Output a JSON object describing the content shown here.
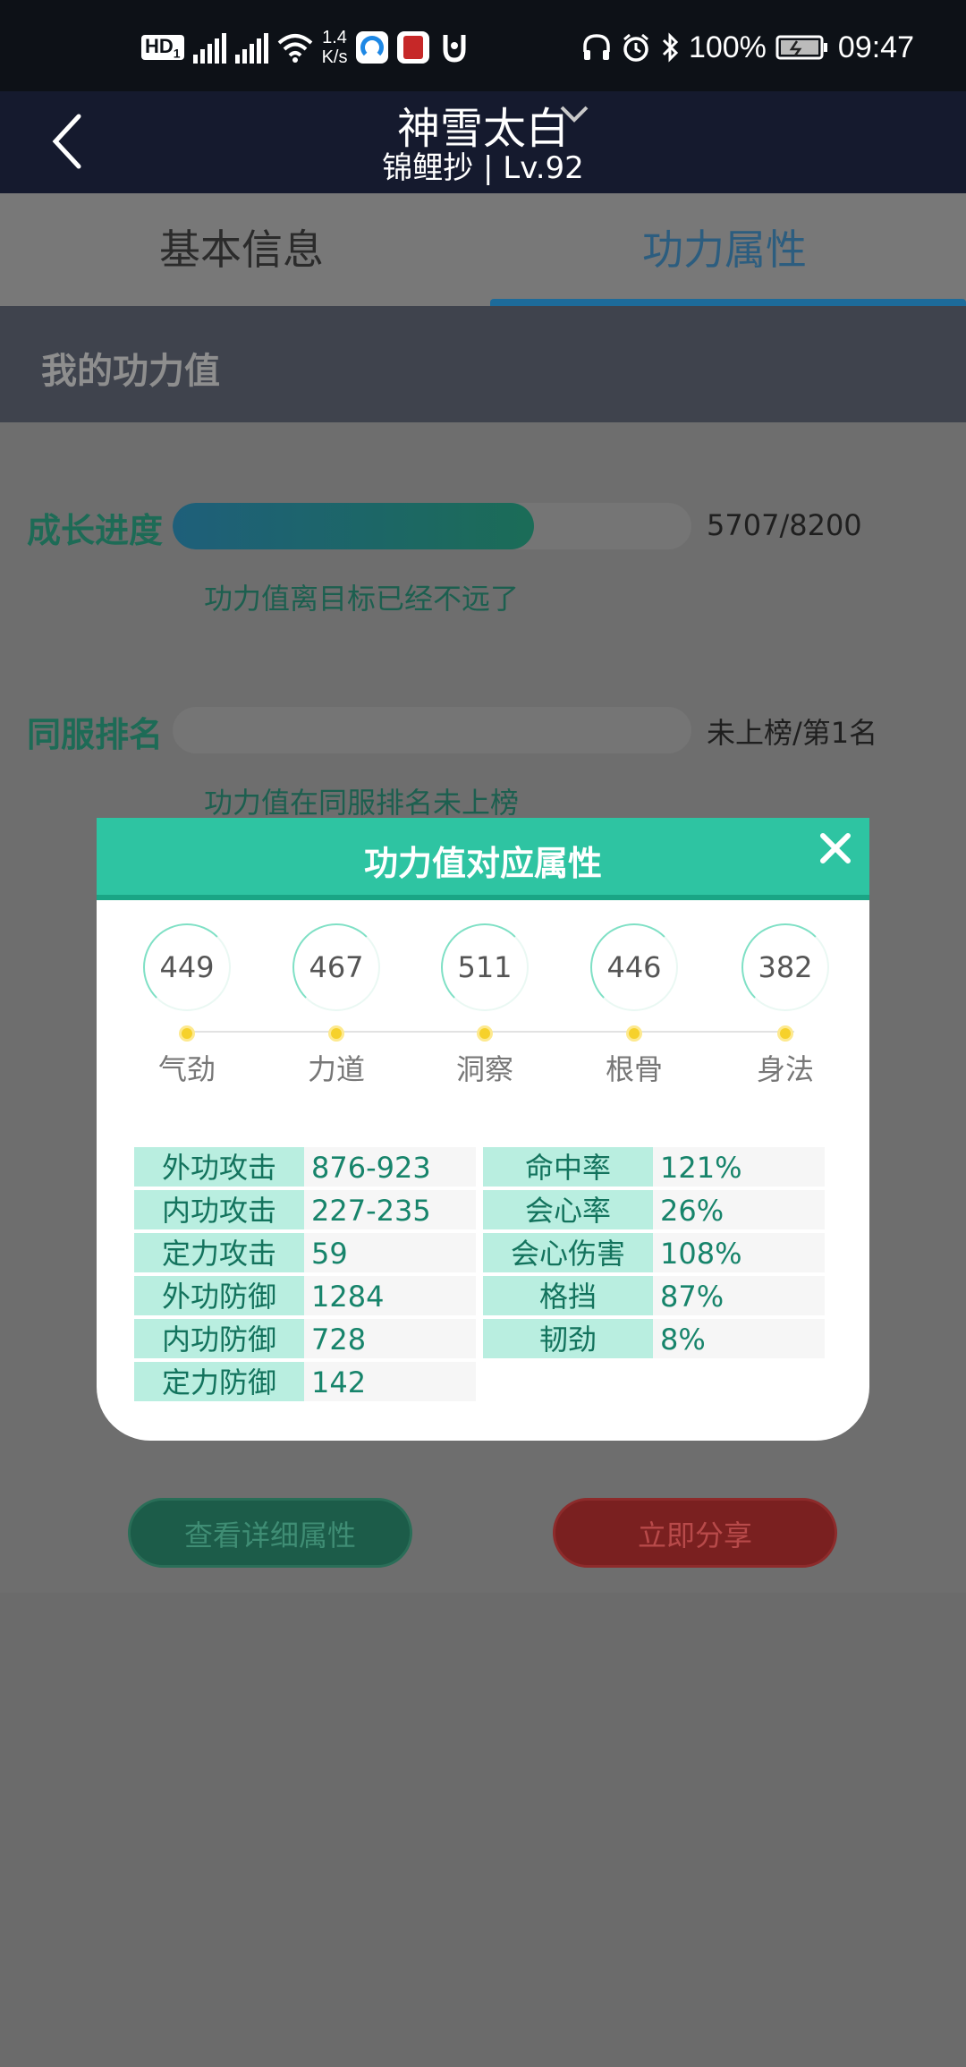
{
  "status_bar": {
    "hd_label": "HD",
    "hd_sub": "1",
    "net_speed_value": "1.4",
    "net_speed_unit": "K/s",
    "battery": "100%",
    "time": "09:47"
  },
  "header": {
    "title": "神雪太白",
    "subtitle": "锦鲤抄 | Lv.92"
  },
  "tabs": [
    {
      "label": "基本信息",
      "active": false
    },
    {
      "label": "功力属性",
      "active": true
    }
  ],
  "section": {
    "title": "我的功力值"
  },
  "growth": {
    "label": "成长进度",
    "current": 5707,
    "target": 8200,
    "value_text": "5707/8200",
    "hint": "功力值离目标已经不远了"
  },
  "ranking": {
    "label": "同服排名",
    "progress": 0,
    "value_text": "未上榜/第1名",
    "hint": "功力值在同服排名未上榜"
  },
  "buttons": {
    "detail": "查看详细属性",
    "share": "立即分享"
  },
  "modal": {
    "title": "功力值对应属性",
    "stats": [
      {
        "value": "449",
        "label": "气劲"
      },
      {
        "value": "467",
        "label": "力道"
      },
      {
        "value": "511",
        "label": "洞察"
      },
      {
        "value": "446",
        "label": "根骨"
      },
      {
        "value": "382",
        "label": "身法"
      }
    ],
    "attributes_left": [
      {
        "name": "外功攻击",
        "value": "876-923"
      },
      {
        "name": "内功攻击",
        "value": "227-235"
      },
      {
        "name": "定力攻击",
        "value": "59"
      },
      {
        "name": "外功防御",
        "value": "1284"
      },
      {
        "name": "内功防御",
        "value": "728"
      },
      {
        "name": "定力防御",
        "value": "142"
      }
    ],
    "attributes_right": [
      {
        "name": "命中率",
        "value": "121%"
      },
      {
        "name": "会心率",
        "value": "26%"
      },
      {
        "name": "会心伤害",
        "value": "108%"
      },
      {
        "name": "格挡",
        "value": "87%"
      },
      {
        "name": "韧劲",
        "value": "8%"
      }
    ]
  },
  "colors": {
    "accent": "#2ec4a2",
    "header_bg": "#151a2e",
    "overlay_bg": "#6b6b6b"
  }
}
